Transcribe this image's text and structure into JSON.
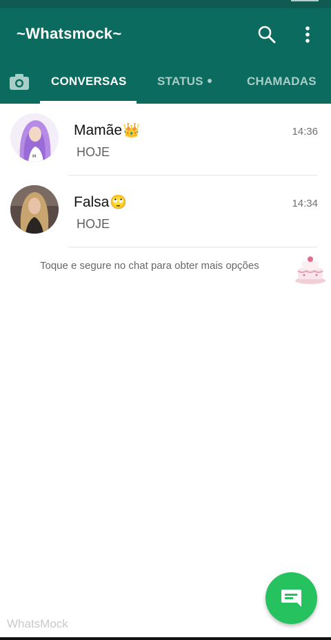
{
  "app": {
    "title": "~Whatsmock~",
    "watermark": "WhatsMock"
  },
  "toolbar": {
    "search_icon": "search-icon",
    "menu_icon": "more-vert-icon"
  },
  "tabs": [
    {
      "label": "CONVERSAS",
      "active": true
    },
    {
      "label": "STATUS",
      "active": false,
      "has_dot": true
    },
    {
      "label": "CHAMADAS",
      "active": false
    }
  ],
  "chats": [
    {
      "name": "Mamãe",
      "emoji": "👑",
      "time": "14:36",
      "preview": "HOJE",
      "avatar": "purple-hair-girl-avatar"
    },
    {
      "name": "Falsa",
      "emoji": "🙄",
      "time": "14:34",
      "preview": "HOJE",
      "avatar": "blonde-girl-avatar"
    }
  ],
  "hint": {
    "text": "Toque e segure no chat para obter mais opções",
    "sticker": "pink-cake-sticker"
  },
  "fab": {
    "icon": "new-chat-icon"
  },
  "colors": {
    "header": "#0c6b5f",
    "status_bar": "#0f5a51",
    "fab": "#25c25f",
    "tab_inactive": "#a9cdc7"
  }
}
